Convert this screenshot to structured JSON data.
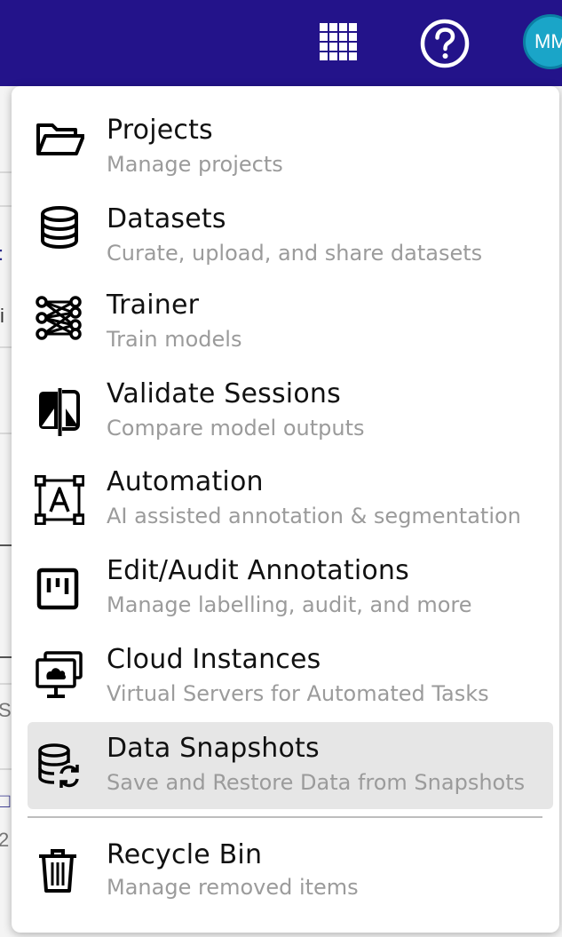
{
  "header": {
    "apps_icon": "grid-apps-icon",
    "help_icon": "help-circle-icon",
    "avatar_initials": "MM",
    "colors": {
      "bar": "#23138a",
      "avatar": "#1aa5c8"
    }
  },
  "background": {
    "fragments": [
      ":",
      "i",
      "S",
      "□",
      "2"
    ]
  },
  "menu": {
    "items": [
      {
        "title": "Projects",
        "subtitle": "Manage projects",
        "icon": "folder-open-icon"
      },
      {
        "title": "Datasets",
        "subtitle": "Curate, upload, and share datasets",
        "icon": "database-icon"
      },
      {
        "title": "Trainer",
        "subtitle": "Train models",
        "icon": "neural-network-icon"
      },
      {
        "title": "Validate Sessions",
        "subtitle": "Compare model outputs",
        "icon": "compare-icon"
      },
      {
        "title": "Automation",
        "subtitle": "AI assisted annotation & segmentation",
        "icon": "text-select-icon"
      },
      {
        "title": "Edit/Audit Annotations",
        "subtitle": "Manage labelling, audit, and more",
        "icon": "board-icon"
      },
      {
        "title": "Cloud Instances",
        "subtitle": "Virtual Servers for Automated Tasks",
        "icon": "cloud-monitor-icon"
      },
      {
        "title": "Data Snapshots",
        "subtitle": "Save and Restore Data from Snapshots",
        "icon": "database-sync-icon",
        "active": true
      },
      {
        "title": "Recycle Bin",
        "subtitle": "Manage removed items",
        "icon": "trash-icon"
      }
    ]
  }
}
